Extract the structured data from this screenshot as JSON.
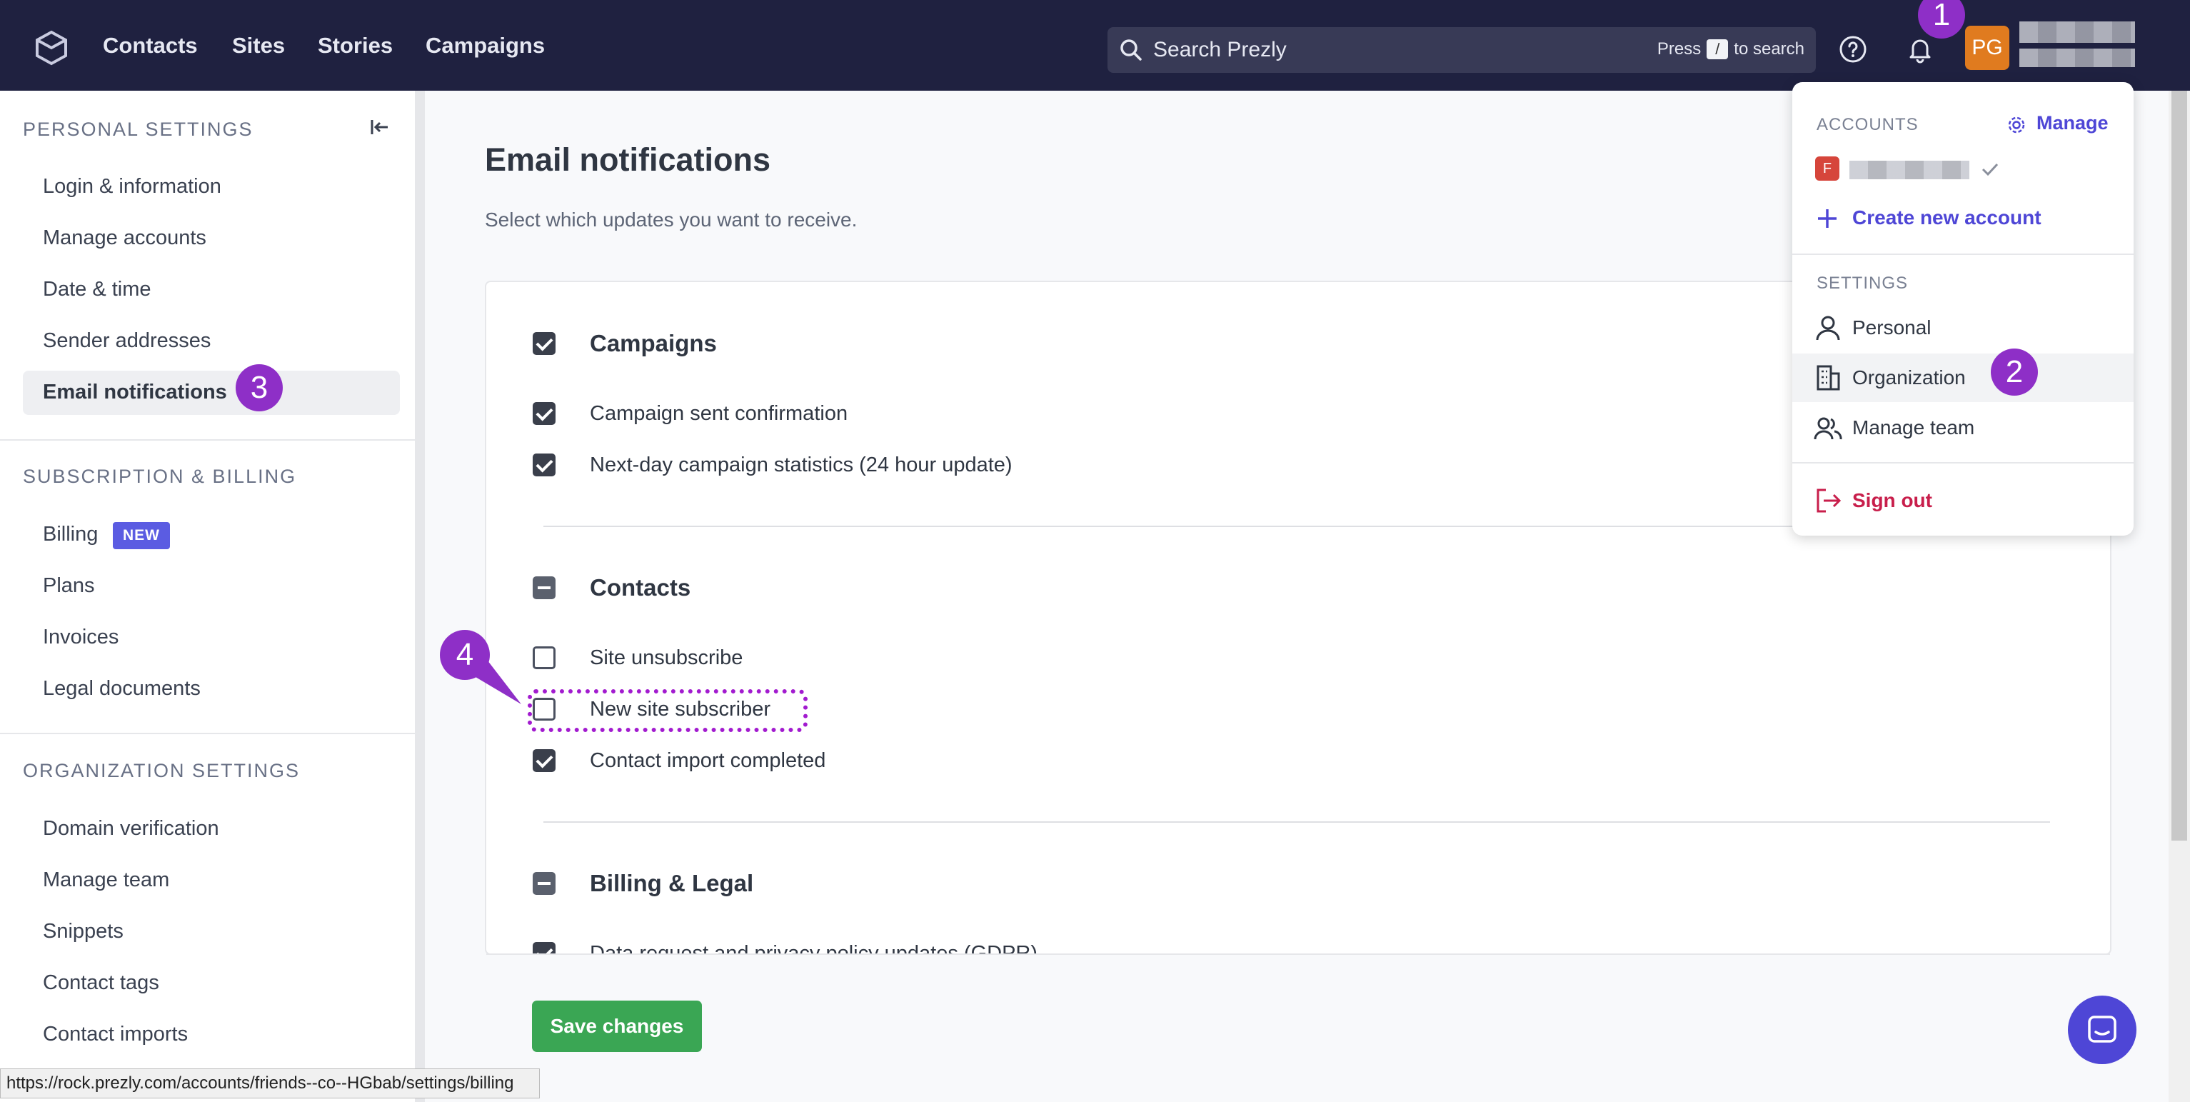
{
  "header": {
    "nav": [
      "Contacts",
      "Sites",
      "Stories",
      "Campaigns"
    ],
    "search_placeholder": "Search Prezly",
    "search_hint_press": "Press",
    "search_hint_key": "/",
    "search_hint_suffix": "to search",
    "avatar_initials": "PG"
  },
  "sidebar": {
    "personal_title": "PERSONAL SETTINGS",
    "personal_items": [
      "Login & information",
      "Manage accounts",
      "Date & time",
      "Sender addresses",
      "Email notifications"
    ],
    "billing_title": "SUBSCRIPTION & BILLING",
    "billing_items": [
      "Billing",
      "Plans",
      "Invoices",
      "Legal documents"
    ],
    "billing_badge": "NEW",
    "org_title": "ORGANIZATION SETTINGS",
    "org_items": [
      "Domain verification",
      "Manage team",
      "Snippets",
      "Contact tags",
      "Contact imports"
    ]
  },
  "main": {
    "title": "Email notifications",
    "subtitle": "Select which updates you want to receive.",
    "groups": [
      {
        "label": "Campaigns",
        "state": "checked",
        "options": [
          {
            "label": "Campaign sent confirmation",
            "checked": true
          },
          {
            "label": "Next-day campaign statistics (24 hour update)",
            "checked": true
          }
        ]
      },
      {
        "label": "Contacts",
        "state": "indeterminate",
        "options": [
          {
            "label": "Site unsubscribe",
            "checked": false
          },
          {
            "label": "New site subscriber",
            "checked": false
          },
          {
            "label": "Contact import completed",
            "checked": true
          }
        ]
      },
      {
        "label": "Billing & Legal",
        "state": "indeterminate",
        "options": [
          {
            "label": "Data request and privacy policy updates (GDPR)",
            "checked": true
          }
        ]
      }
    ],
    "save_label": "Save changes"
  },
  "dropdown": {
    "accounts_title": "ACCOUNTS",
    "manage_label": "Manage",
    "account_initial": "F",
    "create_label": "Create new account",
    "settings_title": "SETTINGS",
    "items": [
      "Personal",
      "Organization",
      "Manage team"
    ],
    "signout_label": "Sign out"
  },
  "annotations": [
    "1",
    "2",
    "3",
    "4"
  ],
  "status_url": "https://rock.prezly.com/accounts/friends--co--HGbab/settings/billing",
  "colors": {
    "nav_bg": "#1f2140",
    "accent": "#4e46d6",
    "save_green": "#3aa654",
    "signout_red": "#c81e4b",
    "annotation_purple": "#8e2fc7",
    "avatar_orange": "#e07b1f"
  }
}
